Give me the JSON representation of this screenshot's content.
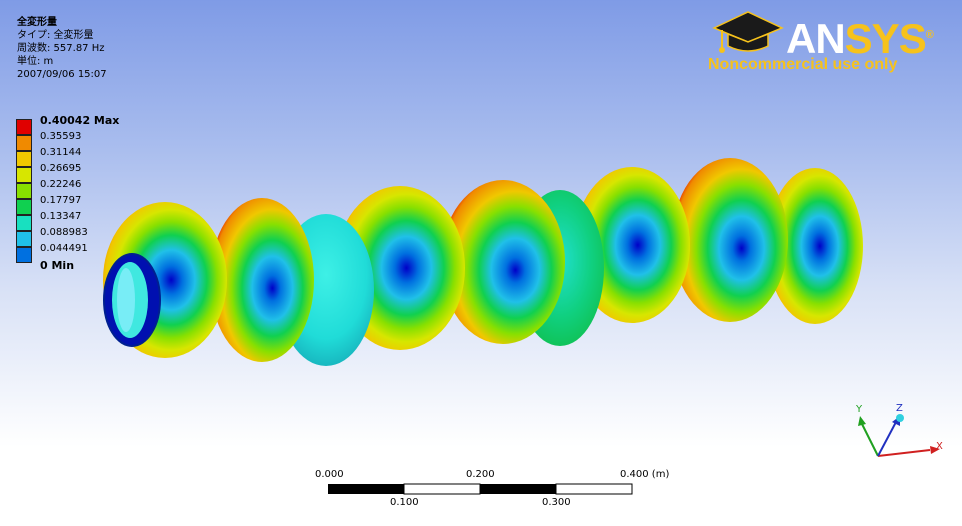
{
  "info": {
    "title": "全変形量",
    "type_line": "タイプ: 全変形量",
    "freq_line": "周波数: 557.87 Hz",
    "unit_line": "単位: m",
    "date_line": "2007/09/06 15:07"
  },
  "legend": {
    "labels": [
      "0.40042 Max",
      "0.35593",
      "0.31144",
      "0.26695",
      "0.22246",
      "0.17797",
      "0.13347",
      "0.088983",
      "0.044491",
      "0 Min"
    ],
    "colors": [
      "#e00000",
      "#f08a00",
      "#f0c800",
      "#d7e600",
      "#88e000",
      "#10d050",
      "#18e0c0",
      "#20c0e8",
      "#0070e0",
      "#0000c8"
    ]
  },
  "logo": {
    "word_main": "AN",
    "word_accent": "SYS",
    "registered": "®",
    "tagline": "Noncommercial use only"
  },
  "scale": {
    "top_labels": [
      "0.000",
      "0.200",
      "0.400 (m)"
    ],
    "bottom_labels": [
      "0.100",
      "0.300"
    ]
  },
  "triad": {
    "x": "X",
    "y": "Y",
    "z": "Z"
  },
  "colors": {
    "x_axis": "#d02020",
    "y_axis": "#20a020",
    "z_axis": "#2030c0"
  }
}
